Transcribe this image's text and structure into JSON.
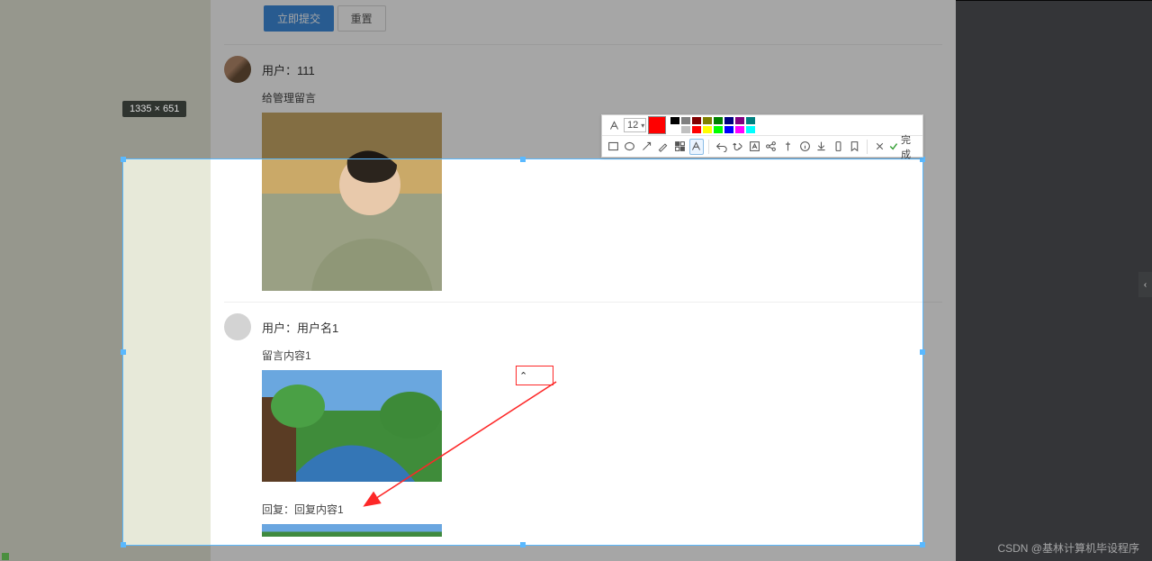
{
  "badge": {
    "dim": "1335 × 651"
  },
  "buttons": {
    "submit": "立即提交",
    "reset": "重置"
  },
  "post1": {
    "user_prefix": "用户：",
    "user_name": "111",
    "caption": "给管理留言"
  },
  "post2": {
    "user_prefix": "用户：",
    "user_name": "用户名1",
    "caption": "留言内容1",
    "reply_prefix": "回复：",
    "reply_text": "回复内容1"
  },
  "toolbar": {
    "font_size": "12",
    "done": "完成",
    "selected_color": "#ff0000",
    "swatches_row1": [
      "#000000",
      "#808080",
      "#800000",
      "#808000",
      "#008000",
      "#000080",
      "#800080",
      "#008080"
    ],
    "swatches_row2": [
      "#ffffff",
      "#c0c0c0",
      "#ff0000",
      "#ffff00",
      "#00ff00",
      "#0000ff",
      "#ff00ff",
      "#00ffff"
    ],
    "icons": [
      "rect",
      "ellipse",
      "arrow",
      "pen",
      "mosaic",
      "text",
      "undo",
      "redo",
      "cut",
      "link",
      "pin",
      "info",
      "download",
      "phone",
      "bookmark",
      "close",
      "done"
    ]
  },
  "side_tab_glyph": "‹",
  "watermark": "CSDN @基林计算机毕设程序"
}
